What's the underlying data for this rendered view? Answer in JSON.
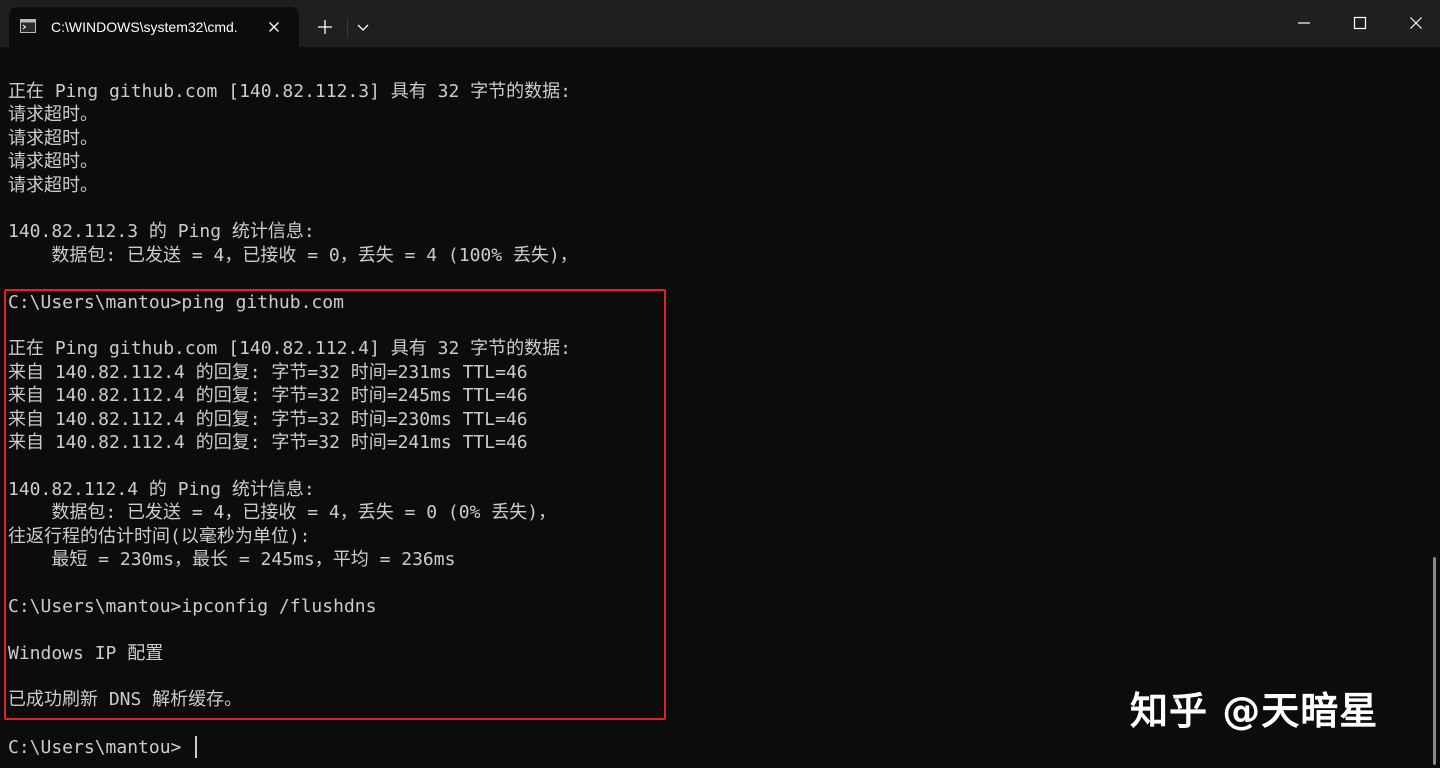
{
  "window": {
    "tab_title": "C:\\WINDOWS\\system32\\cmd.",
    "tab_icon": "cmd-icon",
    "close_tab_icon": "close-icon",
    "new_tab_icon": "plus-icon",
    "dropdown_icon": "chevron-down-icon",
    "minimize_icon": "minimize-icon",
    "maximize_icon": "maximize-icon",
    "close_window_icon": "close-icon"
  },
  "terminal": {
    "lines": [
      "正在 Ping github.com [140.82.112.3] 具有 32 字节的数据:",
      "请求超时。",
      "请求超时。",
      "请求超时。",
      "请求超时。",
      "",
      "140.82.112.3 的 Ping 统计信息:",
      "    数据包: 已发送 = 4，已接收 = 0，丢失 = 4 (100% 丢失)，",
      "",
      "C:\\Users\\mantou>ping github.com",
      "",
      "正在 Ping github.com [140.82.112.4] 具有 32 字节的数据:",
      "来自 140.82.112.4 的回复: 字节=32 时间=231ms TTL=46",
      "来自 140.82.112.4 的回复: 字节=32 时间=245ms TTL=46",
      "来自 140.82.112.4 的回复: 字节=32 时间=230ms TTL=46",
      "来自 140.82.112.4 的回复: 字节=32 时间=241ms TTL=46",
      "",
      "140.82.112.4 的 Ping 统计信息:",
      "    数据包: 已发送 = 4，已接收 = 4，丢失 = 0 (0% 丢失)，",
      "往返行程的估计时间(以毫秒为单位):",
      "    最短 = 230ms，最长 = 245ms，平均 = 236ms",
      "",
      "C:\\Users\\mantou>ipconfig /flushdns",
      "",
      "Windows IP 配置",
      "",
      "已成功刷新 DNS 解析缓存。",
      "",
      "C:\\Users\\mantou>"
    ]
  },
  "colors": {
    "background": "#0c0c0c",
    "text": "#cccccc",
    "highlight_border": "#e0202a",
    "titlebar": "#1f1f1f"
  },
  "watermark": {
    "text": "知乎 @天暗星"
  }
}
